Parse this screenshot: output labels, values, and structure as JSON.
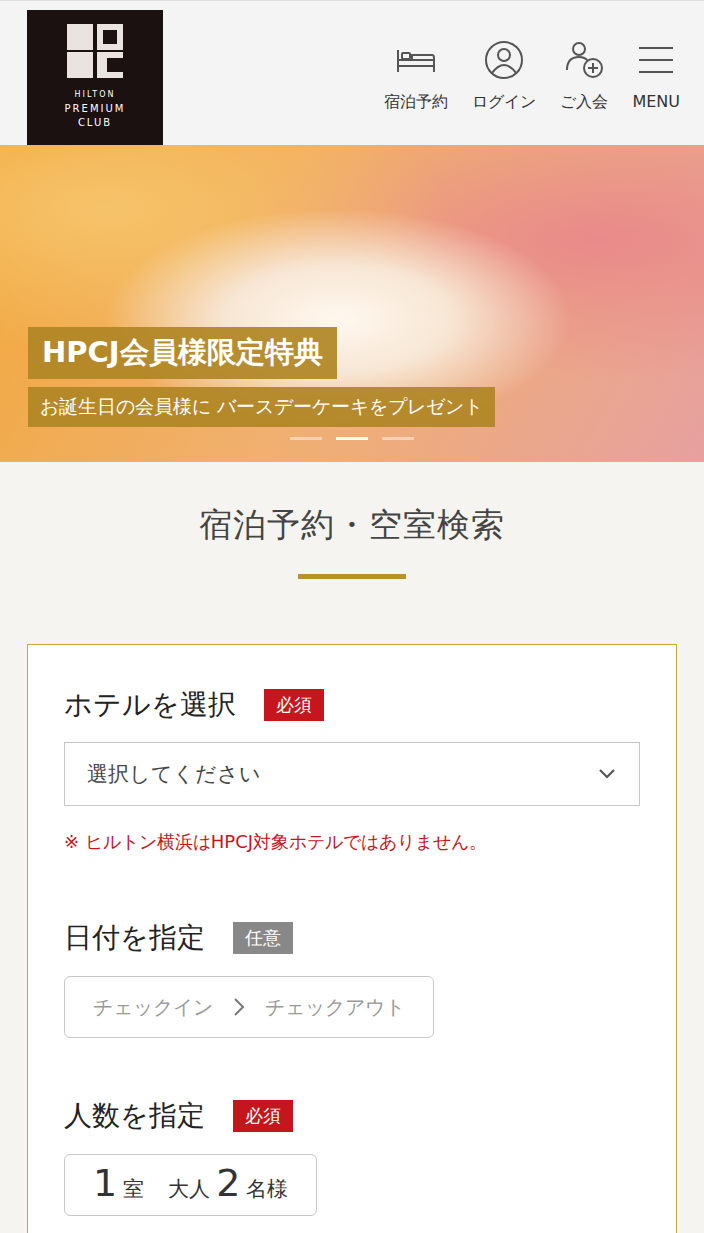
{
  "header": {
    "logo": {
      "lines": [
        "HILTON",
        "PREMIUM",
        "CLUB"
      ]
    },
    "nav": [
      {
        "label": "宿泊予約",
        "kind": "booking"
      },
      {
        "label": "ログイン",
        "kind": "login"
      },
      {
        "label": "ご入会",
        "kind": "signup"
      },
      {
        "label": "MENU",
        "kind": "menu"
      }
    ]
  },
  "banner": {
    "title": "HPCJ会員様限定特典",
    "subtitle": "お誕生日の会員様に バースデーケーキをプレゼント",
    "slides": [
      {
        "selected": false
      },
      {
        "selected": true
      },
      {
        "selected": false
      }
    ]
  },
  "search": {
    "title": "宿泊予約・空室検索",
    "hotel": {
      "label": "ホテルを選択",
      "badge": {
        "text": "必須",
        "required": true
      },
      "placeholder": "選択してください",
      "note": "※ ヒルトン横浜はHPCJ対象ホテルではありません。"
    },
    "dates": {
      "label": "日付を指定",
      "badge": {
        "text": "任意",
        "required": false
      },
      "checkin": "チェックイン",
      "checkout": "チェックアウト"
    },
    "guests": {
      "label": "人数を指定",
      "badge": {
        "text": "必須",
        "required": true
      },
      "rooms": "1",
      "rooms_unit": "室",
      "adults_label": "大人",
      "adults": "2",
      "adults_unit": "名様"
    }
  }
}
